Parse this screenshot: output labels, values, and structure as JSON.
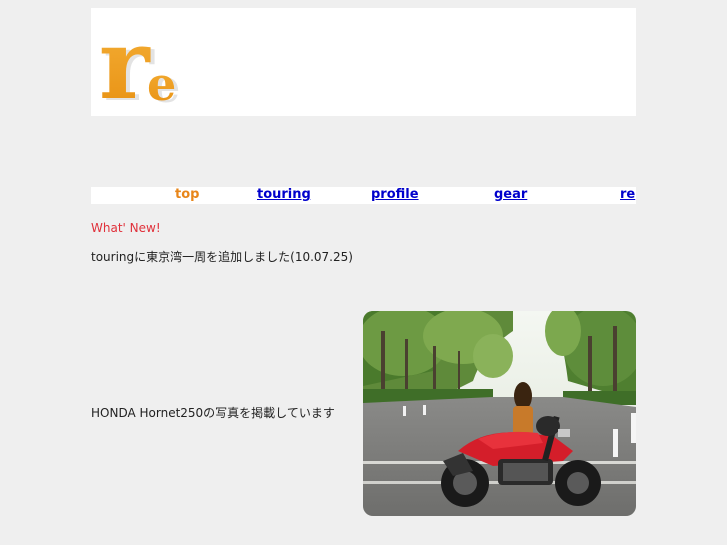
{
  "nav": {
    "items": [
      {
        "label": "top",
        "current": true
      },
      {
        "label": "touring",
        "current": false
      },
      {
        "label": "profile",
        "current": false
      },
      {
        "label": "gear",
        "current": false
      },
      {
        "label": "re",
        "current": false
      }
    ]
  },
  "news": {
    "heading": "What' New!",
    "line": "touringに東京湾一周を追加しました(10.07.25)"
  },
  "feature": {
    "caption": "HONDA Hornet250の写真を掲載しています"
  },
  "colors": {
    "page_bg": "#efefef",
    "link": "#0000cc",
    "current_link": "#e8861a",
    "heading_red": "#e0303a",
    "logo_orange": "#f0a020"
  }
}
